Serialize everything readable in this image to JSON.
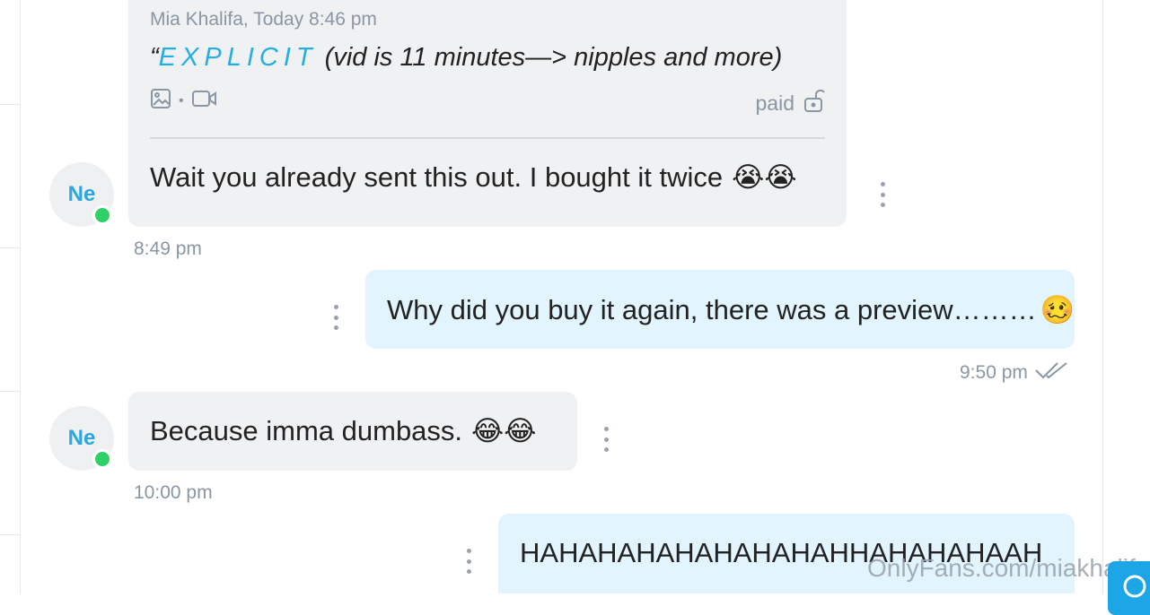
{
  "thread": {
    "quoted_message": {
      "author_line": "Mia Khalifa, Today 8:46 pm",
      "quote_open": "“",
      "highlight": "EXPLICIT",
      "rest": " (vid is 11 minutes—> nipples and more)",
      "media_icons": [
        "image-icon",
        "video-icon"
      ],
      "media_separator": "•",
      "status": "paid",
      "status_icon": "unlock-icon"
    },
    "messages": [
      {
        "direction": "incoming",
        "avatar_initials": "Ne",
        "text": "Wait you already sent this out. I bought it twice",
        "emoji": "😭😭",
        "time": "8:49 pm"
      },
      {
        "direction": "outgoing",
        "text": "Why did you buy it again, there was a preview………",
        "emoji": "🥴",
        "time": "9:50 pm",
        "read_icon": "double-check-icon"
      },
      {
        "direction": "incoming",
        "avatar_initials": "Ne",
        "text": "Because imma dumbass.",
        "emoji": "😂😂",
        "time": "10:00 pm"
      },
      {
        "direction": "outgoing",
        "text": "HAHAHAHAHAHAHAHAHHAHAHAHAAH"
      }
    ]
  },
  "watermark": "OnlyFans.com/miakhalifa",
  "colors": {
    "accent": "#23aee5",
    "incoming_bubble": "#f0f1f3",
    "outgoing_bubble": "#e2f4fd",
    "online": "#2ed168",
    "muted_text": "#8a96a3"
  }
}
